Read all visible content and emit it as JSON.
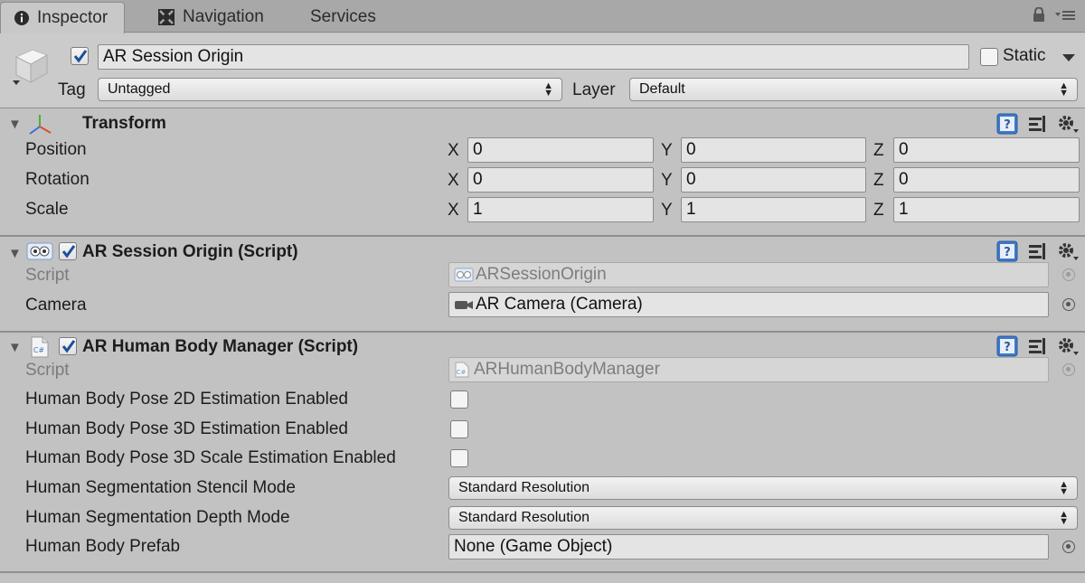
{
  "tabs": [
    {
      "label": "Inspector",
      "icon": "info-icon",
      "active": true
    },
    {
      "label": "Navigation",
      "icon": "navigation-icon",
      "active": false
    },
    {
      "label": "Services",
      "icon": "",
      "active": false
    }
  ],
  "object": {
    "name": "AR Session Origin",
    "active": true,
    "static_label": "Static",
    "static": false,
    "tag_label": "Tag",
    "tag_value": "Untagged",
    "layer_label": "Layer",
    "layer_value": "Default"
  },
  "transform": {
    "title": "Transform",
    "rows": [
      {
        "label": "Position",
        "x": "0",
        "y": "0",
        "z": "0"
      },
      {
        "label": "Rotation",
        "x": "0",
        "y": "0",
        "z": "0"
      },
      {
        "label": "Scale",
        "x": "1",
        "y": "1",
        "z": "1"
      }
    ],
    "axis": {
      "x": "X",
      "y": "Y",
      "z": "Z"
    }
  },
  "session_origin": {
    "title": "AR Session Origin (Script)",
    "enabled": true,
    "script_label": "Script",
    "script_value": "ARSessionOrigin",
    "camera_label": "Camera",
    "camera_value": "AR Camera (Camera)"
  },
  "body_manager": {
    "title": "AR Human Body Manager (Script)",
    "enabled": true,
    "script_label": "Script",
    "script_value": "ARHumanBodyManager",
    "pose2d_label": "Human Body Pose 2D Estimation Enabled",
    "pose3d_label": "Human Body Pose 3D Estimation Enabled",
    "pose3dscale_label": "Human Body Pose 3D Scale Estimation Enabled",
    "stencil_label": "Human Segmentation Stencil Mode",
    "stencil_value": "Standard Resolution",
    "depth_label": "Human Segmentation Depth Mode",
    "depth_value": "Standard Resolution",
    "prefab_label": "Human Body Prefab",
    "prefab_value": "None (Game Object)"
  },
  "colors": {
    "panel": "#c2c2c2",
    "field": "#e4e4e4",
    "tabbar": "#a8a8a8"
  }
}
